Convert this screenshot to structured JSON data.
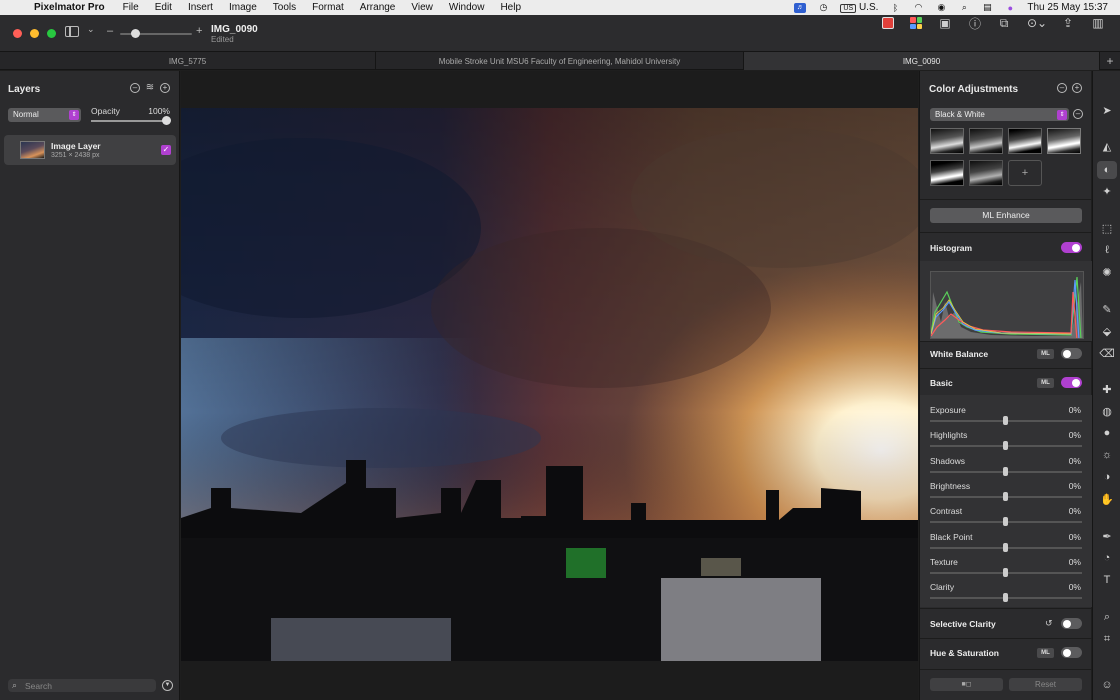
{
  "menubar": {
    "app_name": "Pixelmator Pro",
    "menus": [
      "File",
      "Edit",
      "Insert",
      "Image",
      "Tools",
      "Format",
      "Arrange",
      "View",
      "Window",
      "Help"
    ],
    "input_source": "U.S.",
    "input_badge": "US",
    "datetime": "Thu 25 May  15:37"
  },
  "toolbar": {
    "doc_title": "IMG_0090",
    "doc_status": "Edited"
  },
  "tabs": [
    {
      "label": "IMG_5775"
    },
    {
      "label": "Mobile Stroke Unit MSU6 Faculty of Engineering, Mahidol University"
    },
    {
      "label": "IMG_0090"
    }
  ],
  "layers_panel": {
    "title": "Layers",
    "blend_mode": "Normal",
    "opacity_label": "Opacity",
    "opacity_value": "100%",
    "layer": {
      "name": "Image Layer",
      "size": "3251 × 2438 px"
    },
    "search_placeholder": "Search"
  },
  "color_adjustments": {
    "title": "Color Adjustments",
    "preset": "Black & White",
    "ml_enhance_label": "ML Enhance",
    "histogram_label": "Histogram",
    "histogram_on": true,
    "white_balance_label": "White Balance",
    "white_balance_on": false,
    "basic_label": "Basic",
    "basic_on": true,
    "ml_badge": "ML",
    "sliders": [
      {
        "label": "Exposure",
        "value": "0%"
      },
      {
        "label": "Highlights",
        "value": "0%"
      },
      {
        "label": "Shadows",
        "value": "0%"
      },
      {
        "label": "Brightness",
        "value": "0%"
      },
      {
        "label": "Contrast",
        "value": "0%"
      },
      {
        "label": "Black Point",
        "value": "0%"
      },
      {
        "label": "Texture",
        "value": "0%"
      },
      {
        "label": "Clarity",
        "value": "0%"
      }
    ],
    "selective_clarity_label": "Selective Clarity",
    "hue_saturation_label": "Hue & Saturation",
    "reset_label": "Reset"
  },
  "colors": {
    "accent": "#b040d0",
    "panel": "#2b2b2d"
  }
}
